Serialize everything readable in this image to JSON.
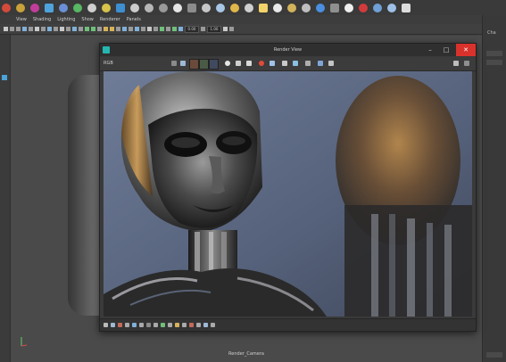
{
  "shelf": {
    "icons": [
      {
        "name": "polygon-sphere-icon",
        "color": "#d24a3a"
      },
      {
        "name": "polygon-cube-icon",
        "color": "#c9a23a"
      },
      {
        "name": "polygon-cylinder-icon",
        "color": "#c23d9b"
      },
      {
        "name": "polygon-cone-icon",
        "color": "#4fa3dc"
      },
      {
        "name": "polygon-torus-icon",
        "color": "#6b8fd6"
      },
      {
        "name": "polygon-plane-icon",
        "color": "#58b864"
      },
      {
        "name": "mesh-tool-icon",
        "color": "#cfcfcf"
      },
      {
        "name": "texture-icon",
        "color": "#d8c24a"
      },
      {
        "name": "material-icon",
        "color": "#3e8fd0"
      },
      {
        "name": "light-icon",
        "color": "#cccccc"
      },
      {
        "name": "camera-icon",
        "color": "#b6b6b6"
      },
      {
        "name": "curve-tool-icon",
        "color": "#999999"
      },
      {
        "name": "sphere-shader-icon",
        "color": "#e6e6e6"
      },
      {
        "name": "grid-icon",
        "color": "#8c8c8c"
      },
      {
        "name": "uv-icon",
        "color": "#c7c7c7"
      },
      {
        "name": "deformer-icon",
        "color": "#a8c6e6"
      },
      {
        "name": "brush-icon",
        "color": "#e0b84a"
      },
      {
        "name": "sculpt-icon",
        "color": "#cfcfcf"
      },
      {
        "name": "bulb-icon",
        "color": "#f1d36a"
      },
      {
        "name": "spotlight-icon",
        "color": "#e9e9e9"
      },
      {
        "name": "cone-light-icon",
        "color": "#d2b35a"
      },
      {
        "name": "area-light-icon",
        "color": "#bfbfbf"
      },
      {
        "name": "blue-sphere-icon",
        "color": "#4a8fe0"
      },
      {
        "name": "shader-ball-icon",
        "color": "#8f8f8f"
      },
      {
        "name": "checker-icon",
        "color": "#efefef"
      },
      {
        "name": "render-icon",
        "color": "#d23b3b"
      },
      {
        "name": "render-settings-icon",
        "color": "#6fa0d8"
      },
      {
        "name": "hypershade-icon",
        "color": "#9ec0e6"
      },
      {
        "name": "help-icon",
        "color": "#dcdcdc"
      }
    ]
  },
  "menubar": {
    "items": [
      "View",
      "Shading",
      "Lighting",
      "Show",
      "Renderer",
      "Panels"
    ]
  },
  "viewport_toolbar": {
    "field_a": "0.00",
    "field_b": "1.00"
  },
  "viewport": {
    "camera_label": "Render_Camera"
  },
  "render_window": {
    "title": "Render View",
    "menu_label": "RGB",
    "minimize_glyph": "–",
    "maximize_glyph": "□",
    "close_glyph": "✕",
    "accent_color": "#25b6b0",
    "close_color": "#d9312b"
  },
  "right_panel": {
    "label": "Cha"
  }
}
